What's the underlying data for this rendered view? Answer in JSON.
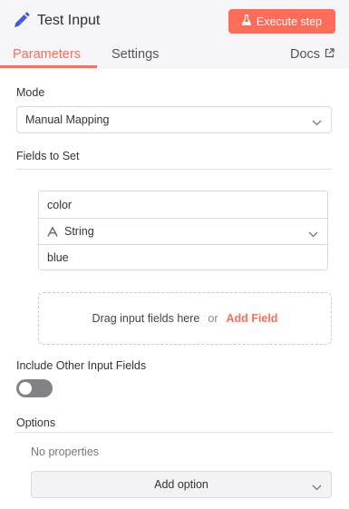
{
  "header": {
    "title": "Test Input",
    "execute_label": "Execute step",
    "tabs": [
      {
        "label": "Parameters",
        "active": true
      },
      {
        "label": "Settings",
        "active": false
      }
    ],
    "docs_label": "Docs"
  },
  "mode": {
    "label": "Mode",
    "value": "Manual Mapping"
  },
  "fields": {
    "label": "Fields to Set",
    "items": [
      {
        "name": "color",
        "type": "String",
        "type_icon": "text-type-icon",
        "value": "blue"
      }
    ],
    "drop_text": "Drag input fields here",
    "or_text": "or",
    "add_field_label": "Add Field"
  },
  "include_other": {
    "label": "Include Other Input Fields",
    "enabled": false
  },
  "options": {
    "label": "Options",
    "empty_text": "No properties",
    "add_option_label": "Add option"
  },
  "colors": {
    "accent": "#ff6d5a",
    "header_bg": "#f5f5f8",
    "icon_blue": "#3e5bd8",
    "toggle_off": "#828287"
  }
}
